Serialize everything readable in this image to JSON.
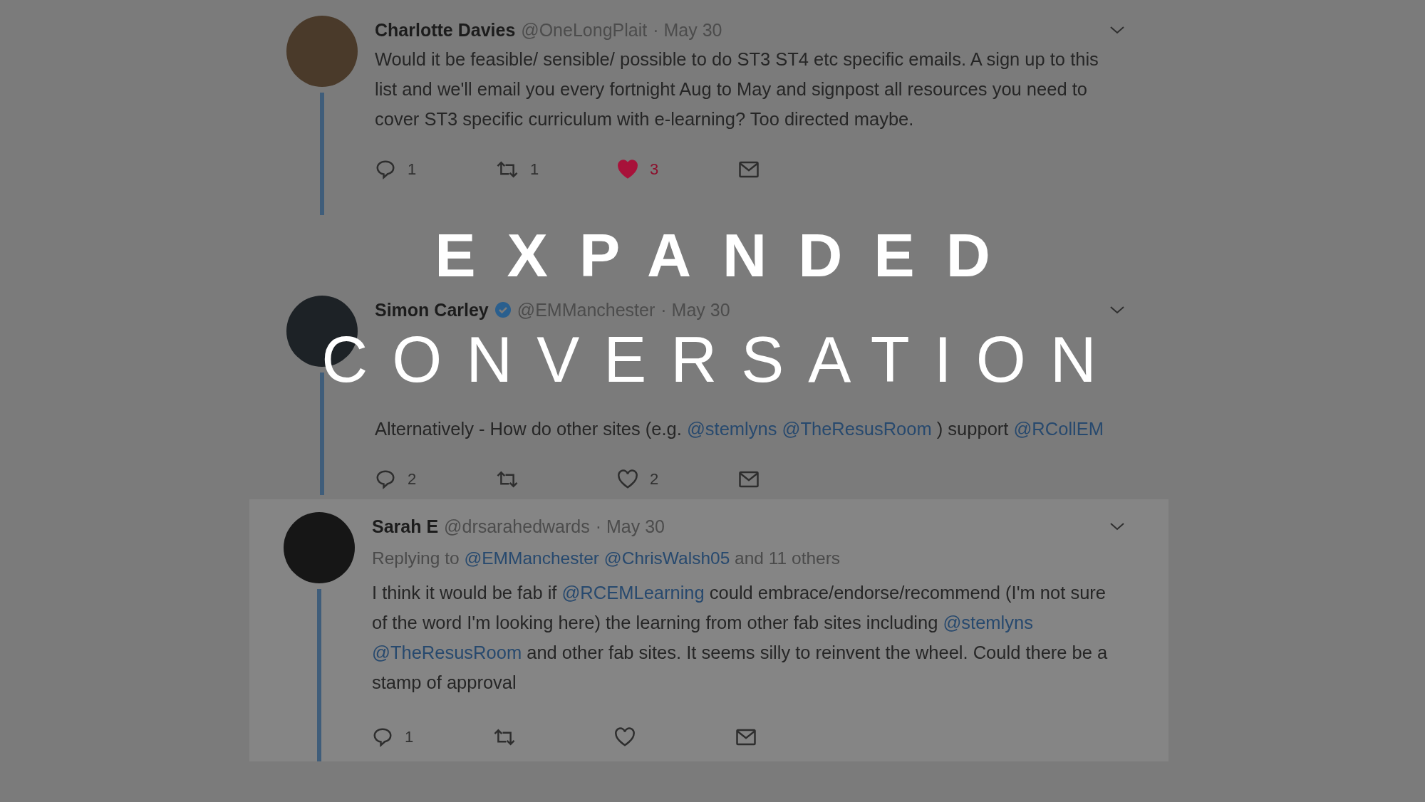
{
  "tweets": [
    {
      "name": "Charlotte Davies",
      "verified": false,
      "handle": "@OneLongPlait",
      "date": "· May 30",
      "highlighted": false,
      "paragraphs": [
        [
          {
            "kind": "plain",
            "text": "Would it be feasible/ sensible/  possible to do ST3 ST4 etc specific emails. A sign up to this list and we'll email you every fortnight Aug to May and signpost all resources you need to cover ST3 specific curriculum with e-learning? Too directed maybe."
          }
        ]
      ],
      "actions": {
        "replies": "1",
        "retweets": "1",
        "likes": "3",
        "liked": true
      }
    },
    {
      "name": "Simon Carley",
      "verified": true,
      "handle": "@EMManchester",
      "date": "· May 30",
      "highlighted": false,
      "paragraphs": [
        [
          {
            "kind": "plain",
            "text": "Alternatively - How do other sites (e.g. "
          },
          {
            "kind": "mention",
            "text": "@stemlyns"
          },
          {
            "kind": "mention",
            "text": "@TheResusRoom"
          },
          {
            "kind": "plain",
            "text": " ) support "
          },
          {
            "kind": "mention",
            "text": "@RCollEM"
          }
        ]
      ],
      "actions": {
        "replies": "2",
        "likes": "2",
        "liked": false
      }
    },
    {
      "name": "Sarah E",
      "verified": false,
      "handle": "@drsarahedwards",
      "date": "· May 30",
      "highlighted": true,
      "replying_to": [
        {
          "kind": "plain",
          "text": "Replying to "
        },
        {
          "kind": "mention",
          "text": "@EMManchester"
        },
        {
          "kind": "mention",
          "text": "@ChrisWalsh05"
        },
        {
          "kind": "plain",
          "text": " and 11 others"
        }
      ],
      "paragraphs": [
        [
          {
            "kind": "plain",
            "text": "I think it would be fab if "
          },
          {
            "kind": "mention",
            "text": "@RCEMLearning"
          },
          {
            "kind": "plain",
            "text": " could embrace/endorse/recommend (I'm not sure of the word I'm looking here) the learning from other fab sites including "
          },
          {
            "kind": "mention",
            "text": "@stemlyns"
          },
          {
            "kind": "mention",
            "text": "@TheResusRoom"
          },
          {
            "kind": "plain",
            "text": " and other fab sites. It seems silly to reinvent the wheel. Could there be a stamp of approval"
          }
        ]
      ],
      "actions": {
        "replies": "1",
        "liked": false
      }
    }
  ],
  "overlay": {
    "line_1": "EXPANDED",
    "line_2": "CONVERSATION"
  }
}
